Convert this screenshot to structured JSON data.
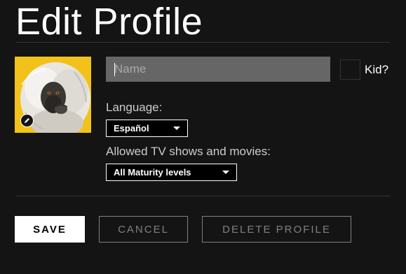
{
  "header": {
    "title": "Edit Profile"
  },
  "profile": {
    "avatar_description": "monkey-avatar",
    "edit_icon": "pencil-icon"
  },
  "name_field": {
    "value": "",
    "placeholder": "Name"
  },
  "kid": {
    "label": "Kid?",
    "checked": false
  },
  "language": {
    "label": "Language:",
    "selected": "Español"
  },
  "maturity": {
    "label": "Allowed TV shows and movies:",
    "selected": "All Maturity levels"
  },
  "actions": {
    "save_label": "SAVE",
    "cancel_label": "CANCEL",
    "delete_label": "DELETE PROFILE"
  },
  "colors": {
    "background": "#141414",
    "input_bg": "#666666",
    "muted_button": "#808080",
    "divider": "#333333"
  }
}
